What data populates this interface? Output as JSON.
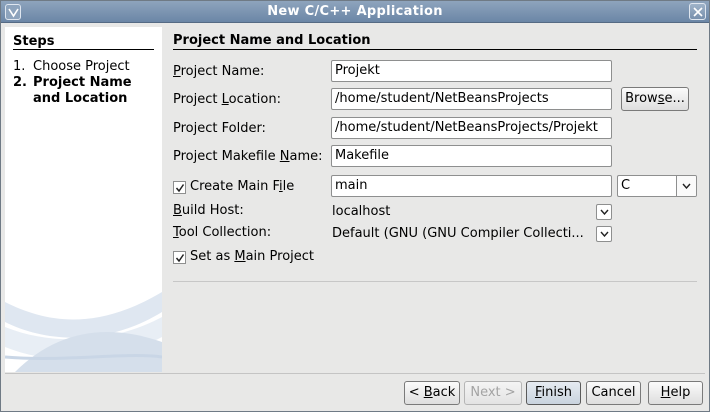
{
  "window": {
    "title": "New C/C++ Application"
  },
  "steps": {
    "heading": "Steps",
    "items": [
      {
        "num": "1.",
        "label": "Choose Project"
      },
      {
        "num": "2.",
        "label_line1": "Project Name",
        "label_line2": "and Location"
      }
    ]
  },
  "main": {
    "title": "Project Name and Location",
    "fields": {
      "project_name": {
        "label_pre": "",
        "label_mnemonic": "P",
        "label_post": "roject Name:",
        "value": "Projekt"
      },
      "project_location": {
        "label_pre": "Project ",
        "label_mnemonic": "L",
        "label_post": "ocation:",
        "value": "/home/student/NetBeansProjects"
      },
      "project_folder": {
        "label": "Project Folder:",
        "value": "/home/student/NetBeansProjects/Projekt"
      },
      "makefile_name": {
        "label_pre": "Project Makefile ",
        "label_mnemonic": "N",
        "label_post": "ame:",
        "value": "Makefile"
      },
      "main_file": {
        "label_pre": "Create Main F",
        "label_mnemonic": "i",
        "label_post": "le",
        "value": "main",
        "checked": true,
        "language": "C"
      },
      "build_host": {
        "label_pre": "",
        "label_mnemonic": "B",
        "label_post": "uild Host:",
        "value": "localhost"
      },
      "tool_collection": {
        "label_pre": "",
        "label_mnemonic": "T",
        "label_post": "ool Collection:",
        "value": "Default (GNU (GNU Compiler Collecti..."
      },
      "set_main": {
        "label_pre": "Set as ",
        "label_mnemonic": "M",
        "label_post": "ain Project",
        "checked": true
      }
    },
    "browse": {
      "pre": "Brow",
      "mnemonic": "s",
      "post": "e..."
    }
  },
  "buttons": {
    "back": {
      "pre": "< ",
      "mnemonic": "B",
      "post": "ack"
    },
    "next": {
      "label": "Next >"
    },
    "finish": {
      "pre": "",
      "mnemonic": "F",
      "post": "inish"
    },
    "cancel": {
      "label": "Cancel"
    },
    "help": {
      "pre": "",
      "mnemonic": "H",
      "post": "elp"
    }
  },
  "colors": {
    "titlebar": "#7b93b0",
    "panel": "#e8e8e7",
    "steps_bg": "#ffffff"
  }
}
